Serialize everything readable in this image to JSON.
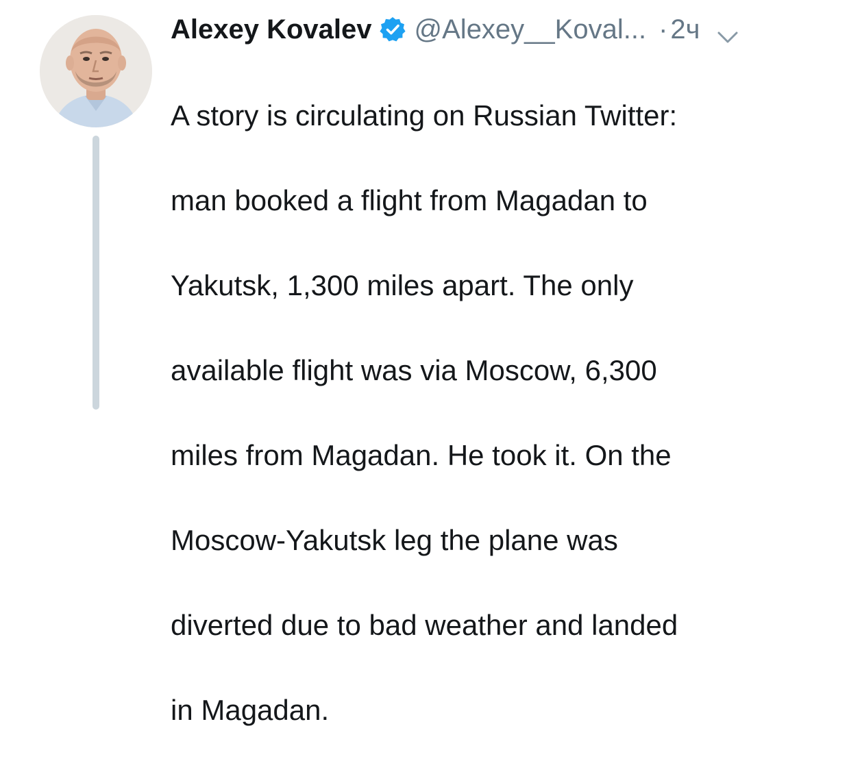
{
  "tweet": {
    "author": {
      "display_name": "Alexey Kovalev",
      "handle": "@Alexey__Koval...",
      "verified": true,
      "avatar_icon": "profile-photo-bald-man"
    },
    "separator": "·",
    "timestamp": "2ч",
    "menu_icon": "chevron-down-icon",
    "text_lines": [
      "A story is circulating on Russian Twitter:",
      "man booked a flight from Magadan to",
      "Yakutsk, 1,300 miles apart. The only",
      "available flight was via Moscow, 6,300",
      "miles from Magadan. He took it. On the",
      "Moscow-Yakutsk leg the plane was",
      "diverted due to bad weather and landed",
      "in Magadan."
    ]
  },
  "colors": {
    "text": "#14171a",
    "secondary": "#657786",
    "verified_badge": "#1da1f2",
    "thread_line": "#ccd6dd"
  }
}
